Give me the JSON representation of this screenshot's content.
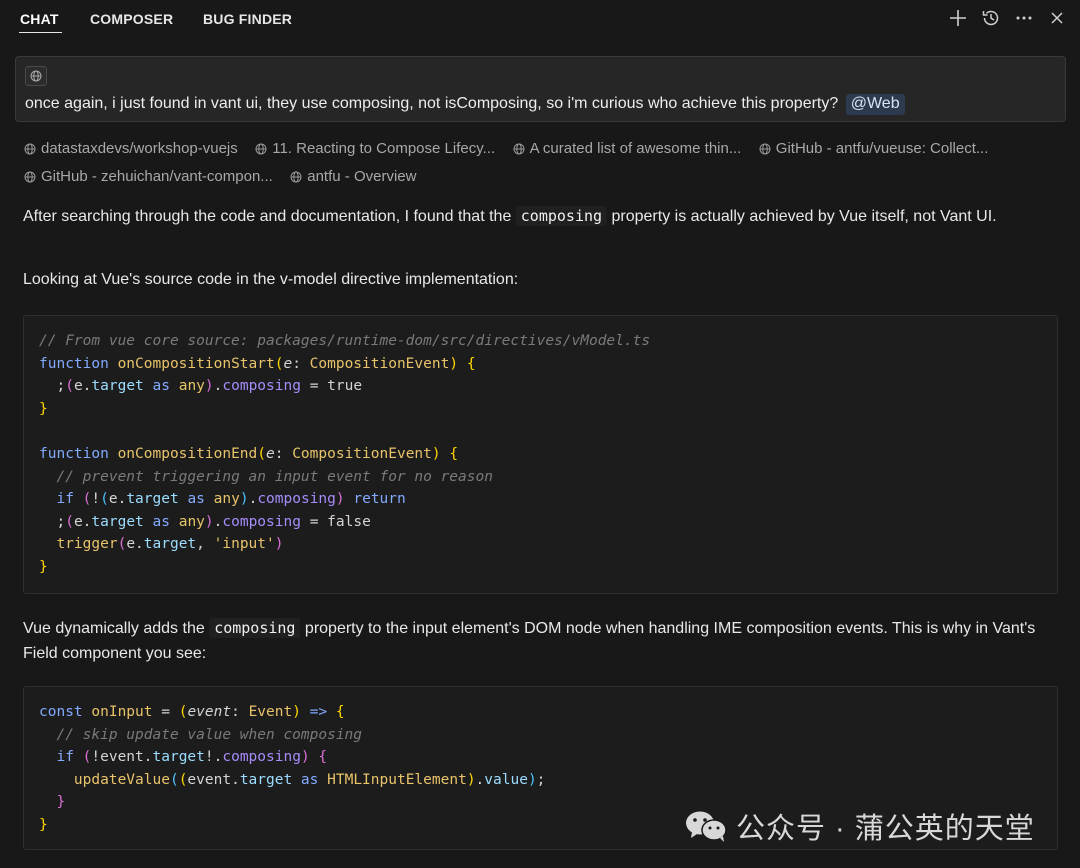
{
  "header": {
    "tabs": [
      {
        "label": "CHAT",
        "active": true
      },
      {
        "label": "COMPOSER",
        "active": false
      },
      {
        "label": "BUG FINDER",
        "active": false
      }
    ],
    "icons": [
      "plus-icon",
      "history-icon",
      "more-icon",
      "close-icon"
    ]
  },
  "user_message": {
    "chip_icon": "globe-icon",
    "text": "once again, i just found in vant ui, they use composing, not isComposing, so i'm curious who achieve this property?",
    "tag": "@Web"
  },
  "sources": [
    [
      "datastaxdevs/workshop-vuejs",
      "11. Reacting to Compose Lifecy...",
      "A curated list of awesome thin...",
      "GitHub - antfu/vueuse: Collect..."
    ],
    [
      "GitHub - zehuichan/vant-compon...",
      "antfu - Overview"
    ]
  ],
  "answer": {
    "p1_before": "After searching through the code and documentation, I found that the ",
    "p1_code": "composing",
    "p1_after": " property is actually achieved by Vue itself, not Vant UI.",
    "p2": "Looking at Vue's source code in the v-model directive implementation:",
    "p3_before": "Vue dynamically adds the ",
    "p3_code": "composing",
    "p3_after": " property to the input element's DOM node when handling IME composition events. This is why in Vant's Field component you see:"
  },
  "code_block_1": {
    "comment1": "// From vue core source: packages/runtime-dom/src/directives/vModel.ts",
    "fn1": "onCompositionStart",
    "fn2": "onCompositionEnd",
    "comment2": "// prevent triggering an input event for no reason",
    "type": "CompositionEvent",
    "input_str": "'input'"
  },
  "code_block_2": {
    "fn": "onInput",
    "comment": "// skip update value when composing",
    "type": "Event",
    "cast_type": "HTMLInputElement",
    "call": "updateValue"
  },
  "watermark": {
    "text": "公众号 · 蒲公英的天堂"
  }
}
